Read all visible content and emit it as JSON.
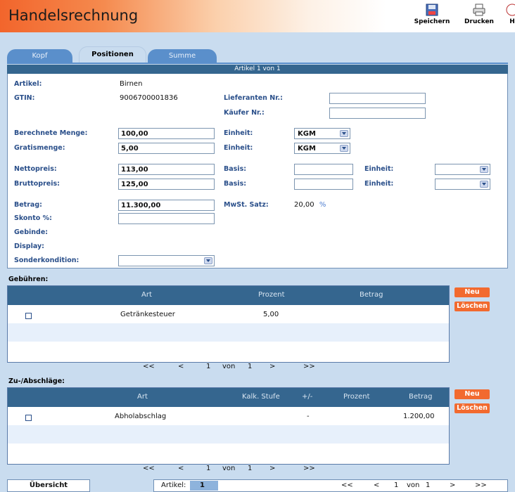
{
  "header": {
    "title": "Handelsrechnung",
    "tools": [
      {
        "label": "Speichern",
        "icon": "floppy-icon"
      },
      {
        "label": "Drucken",
        "icon": "printer-icon"
      },
      {
        "label": "H",
        "icon": "help-icon"
      }
    ]
  },
  "tabs": [
    {
      "label": "Kopf"
    },
    {
      "label": "Positionen"
    },
    {
      "label": "Summe"
    }
  ],
  "article": {
    "counter": "Artikel 1 von 1",
    "artikel_label": "Artikel:",
    "artikel_value": "Birnen",
    "gtin_label": "GTIN:",
    "gtin_value": "9006700001836",
    "lieferanten_label": "Lieferanten Nr.:",
    "lieferanten_value": "",
    "kaeufer_label": "Käufer Nr.:",
    "kaeufer_value": "",
    "menge_label": "Berechnete Menge:",
    "menge_value": "100,00",
    "gratis_label": "Gratismenge:",
    "gratis_value": "5,00",
    "einheit_label": "Einheit:",
    "einheit1_value": "KGM",
    "einheit2_value": "KGM",
    "netto_label": "Nettopreis:",
    "netto_value": "113,00",
    "brutto_label": "Bruttopreis:",
    "brutto_value": "125,00",
    "basis_label": "Basis:",
    "basis1_value": "",
    "basis2_value": "",
    "einheit3_value": "",
    "einheit4_value": "",
    "betrag_label": "Betrag:",
    "betrag_value": "11.300,00",
    "mwst_label": "MwSt. Satz:",
    "mwst_value": "20,00",
    "mwst_unit": "%",
    "skonto_label": "Skonto %:",
    "skonto_value": "",
    "gebinde_label": "Gebinde:",
    "display_label": "Display:",
    "sonder_label": "Sonderkondition:",
    "sonder_value": ""
  },
  "gebuehren": {
    "title": "Gebühren:",
    "columns": [
      "Art",
      "Prozent",
      "Betrag"
    ],
    "rows": [
      {
        "art": "Getränkesteuer",
        "prozent": "5,00",
        "betrag": ""
      }
    ],
    "btn_new": "Neu",
    "btn_delete": "Löschen",
    "pager": {
      "first": "<<",
      "prev": "<",
      "page": "1",
      "von": "von",
      "total": "1",
      "next": ">",
      "last": ">>"
    }
  },
  "zuabschlaege": {
    "title": "Zu-/Abschläge:",
    "columns": [
      "Art",
      "Kalk. Stufe",
      "+/-",
      "Prozent",
      "Betrag"
    ],
    "rows": [
      {
        "art": "Abholabschlag",
        "kalk": "",
        "sign": "-",
        "prozent": "",
        "betrag": "1.200,00"
      }
    ],
    "btn_new": "Neu",
    "btn_delete": "Löschen",
    "pager": {
      "first": "<<",
      "prev": "<",
      "page": "1",
      "von": "von",
      "total": "1",
      "next": ">",
      "last": ">>"
    }
  },
  "footer": {
    "overview_button": "Übersicht",
    "artikel_label": "Artikel:",
    "artikel_value": "1",
    "pager": {
      "first": "<<",
      "prev": "<",
      "page": "1",
      "von": "von",
      "total": "1",
      "next": ">",
      "last": ">>"
    }
  },
  "colors": {
    "accent": "#f26a2f",
    "primary": "#35668f",
    "background": "#c9dcef"
  }
}
